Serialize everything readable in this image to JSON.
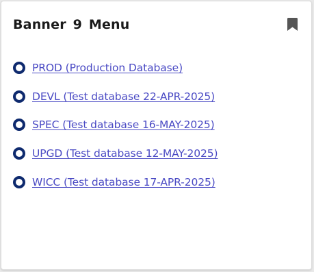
{
  "card": {
    "title": "Banner 9 Menu",
    "bookmark_icon": "bookmark-icon"
  },
  "menu": {
    "items": [
      {
        "label": "PROD (Production Database)"
      },
      {
        "label": "DEVL (Test database 22-APR-2025)"
      },
      {
        "label": "SPEC (Test database 16-MAY-2025)"
      },
      {
        "label": "UPGD (Test database 12-MAY-2025)"
      },
      {
        "label": "WICC (Test database 17-APR-2025)"
      }
    ]
  },
  "colors": {
    "title_text": "#1a1a1a",
    "link_text": "#4a4ac4",
    "radio_ring": "#0e2a6e",
    "icon": "#555555"
  }
}
